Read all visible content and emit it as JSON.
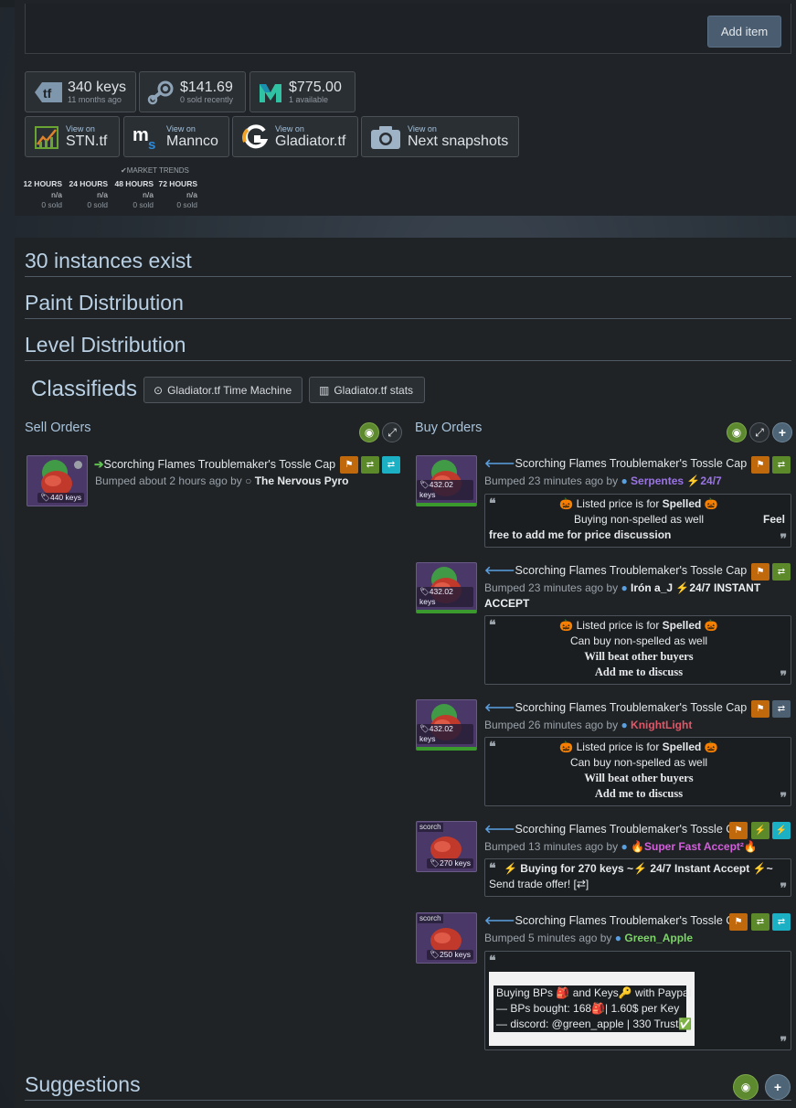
{
  "toolbar": {
    "add_item": "Add item"
  },
  "prices": {
    "backpack": {
      "value": "340 keys",
      "sub": "11 months ago"
    },
    "steam": {
      "value": "$141.69",
      "sub": "0 sold recently"
    },
    "marketplace": {
      "value": "$775.00",
      "sub": "1 available"
    }
  },
  "links": [
    {
      "view_on": "View on",
      "name": "STN.tf"
    },
    {
      "view_on": "View on",
      "name": "Mannco"
    },
    {
      "view_on": "View on",
      "name": "Gladiator.tf"
    },
    {
      "view_on": "View on",
      "name": "Next snapshots"
    }
  ],
  "market_trends": {
    "title": "MARKET TRENDS",
    "columns": [
      {
        "period": "12 HOURS",
        "value": "n/a",
        "sold": "0 sold"
      },
      {
        "period": "24 HOURS",
        "value": "n/a",
        "sold": "0 sold"
      },
      {
        "period": "48 HOURS",
        "value": "n/a",
        "sold": "0 sold"
      },
      {
        "period": "72 HOURS",
        "value": "n/a",
        "sold": "0 sold"
      }
    ]
  },
  "sections": {
    "instances": "30 instances exist",
    "paint": "Paint Distribution",
    "level": "Level Distribution",
    "classifieds": "Classifieds",
    "suggestions": "Suggestions"
  },
  "classifieds_buttons": {
    "time_machine": "Gladiator.tf Time Machine",
    "stats": "Gladiator.tf stats"
  },
  "sell_orders": {
    "heading": "Sell Orders",
    "items": [
      {
        "title": "Scorching Flames Troublemaker's Tossle Cap",
        "price": "440 keys",
        "bumped": "Bumped about 2 hours ago by",
        "user": "The Nervous Pyro"
      }
    ]
  },
  "buy_orders": {
    "heading": "Buy Orders",
    "items": [
      {
        "title": "Scorching Flames Troublemaker's Tossle Cap",
        "price": "432.02 keys",
        "bumped": "Bumped 23 minutes ago by",
        "user": "Serpentes",
        "user_extra": "24/7",
        "q1": "Listed price is for",
        "q1b": "Spelled",
        "q2": "Buying non-spelled as well",
        "q3": "Feel",
        "q4": "free to add me for price discussion"
      },
      {
        "title": "Scorching Flames Troublemaker's Tossle Cap",
        "price": "432.02 keys",
        "bumped": "Bumped 23 minutes ago by",
        "user": "Irón a_J",
        "user_extra": "24/7 INSTANT",
        "user_extra2": "ACCEPT",
        "q1": "Listed price is for",
        "q1b": "Spelled",
        "q2": "Can buy non-spelled as well",
        "q3": "Will beat other buyers",
        "q4": "Add me to discuss"
      },
      {
        "title": "Scorching Flames Troublemaker's Tossle Cap",
        "price": "432.02 keys",
        "bumped": "Bumped 26 minutes ago by",
        "user": "KnightLight",
        "q1": "Listed price is for",
        "q1b": "Spelled",
        "q2": "Can buy non-spelled as well",
        "q3": "Will beat other buyers",
        "q4": "Add me to discuss"
      },
      {
        "title": "Scorching Flames Troublemaker's Tossle Cap",
        "price": "270 keys",
        "tag": "scorch",
        "bumped": "Bumped 13 minutes ago by",
        "user": "Super Fast Accept²",
        "q1": "Buying for 270 keys ~",
        "q1b": "24/7 Instant Accept",
        "q1c": "~",
        "q2": "Send trade offer! [⇄]"
      },
      {
        "title": "Scorching Flames Troublemaker's Tossle Cap",
        "price": "250 keys",
        "tag": "scorch",
        "bumped": "Bumped 5 minutes ago by",
        "user": "Green_Apple",
        "q1": "Buying BPs",
        "q1b": "and Keys",
        "q1c": "with Paypal",
        "q2": "— BPs bought: 168",
        "q2b": "| 1.60$ per Key",
        "q3": "— discord: @green_apple | 330 Trust"
      }
    ]
  },
  "colors": {
    "accent": "#b9d0e4",
    "sell_arrow": "#5fc14f",
    "buy_arrow": "#5a9fe0"
  }
}
